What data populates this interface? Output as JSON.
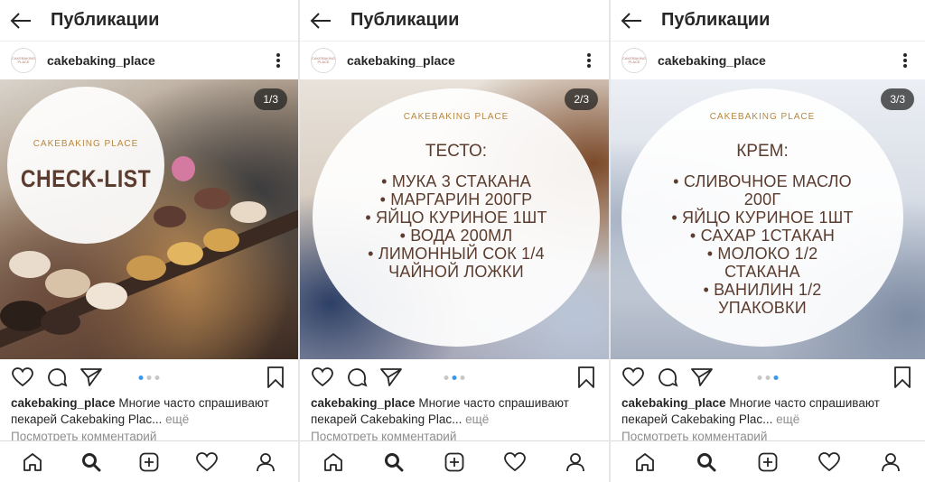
{
  "screen_title": "Публикации",
  "username": "cakebaking_place",
  "avatar_text": "CAKEBAKING PLACE",
  "caption": {
    "username": "cakebaking_place",
    "text": "Многие часто спрашивают пекарей Cakebaking Plac...",
    "more": "ещё"
  },
  "view_comments": "Посмотреть комментарий",
  "icons": {
    "back": "arrow-left-icon",
    "more": "more-vertical-icon",
    "like": "heart-icon",
    "comment": "comment-icon",
    "share": "send-icon",
    "bookmark": "bookmark-icon",
    "home": "home-icon",
    "search": "search-icon",
    "add": "add-post-icon",
    "activity": "heart-icon",
    "profile": "profile-icon"
  },
  "colors": {
    "accent_blue": "#3897f0",
    "brand_gold": "#b8873e",
    "text_brown": "#5b3c2e"
  },
  "posts": [
    {
      "counter": "1/3",
      "brand": "CAKEBAKING PLACE",
      "headline": "CHECK-LIST"
    },
    {
      "counter": "2/3",
      "brand": "CAKEBAKING PLACE",
      "section_title": "ТЕСТО:",
      "lines": [
        "• МУКА 3 СТАКАНА",
        "• МАРГАРИН 200ГР",
        "• ЯЙЦО КУРИНОЕ 1ШТ",
        "• ВОДА 200МЛ",
        "• ЛИМОННЫЙ СОК 1/4",
        "ЧАЙНОЙ ЛОЖКИ"
      ]
    },
    {
      "counter": "3/3",
      "brand": "CAKEBAKING PLACE",
      "section_title": "КРЕМ:",
      "lines": [
        "• СЛИВОЧНОЕ МАСЛО",
        "200Г",
        "• ЯЙЦО КУРИНОЕ 1ШТ",
        "• САХАР 1СТАКАН",
        "• МОЛОКО 1/2",
        "СТАКАНА",
        "• ВАНИЛИН 1/2",
        "УПАКОВКИ"
      ]
    }
  ]
}
